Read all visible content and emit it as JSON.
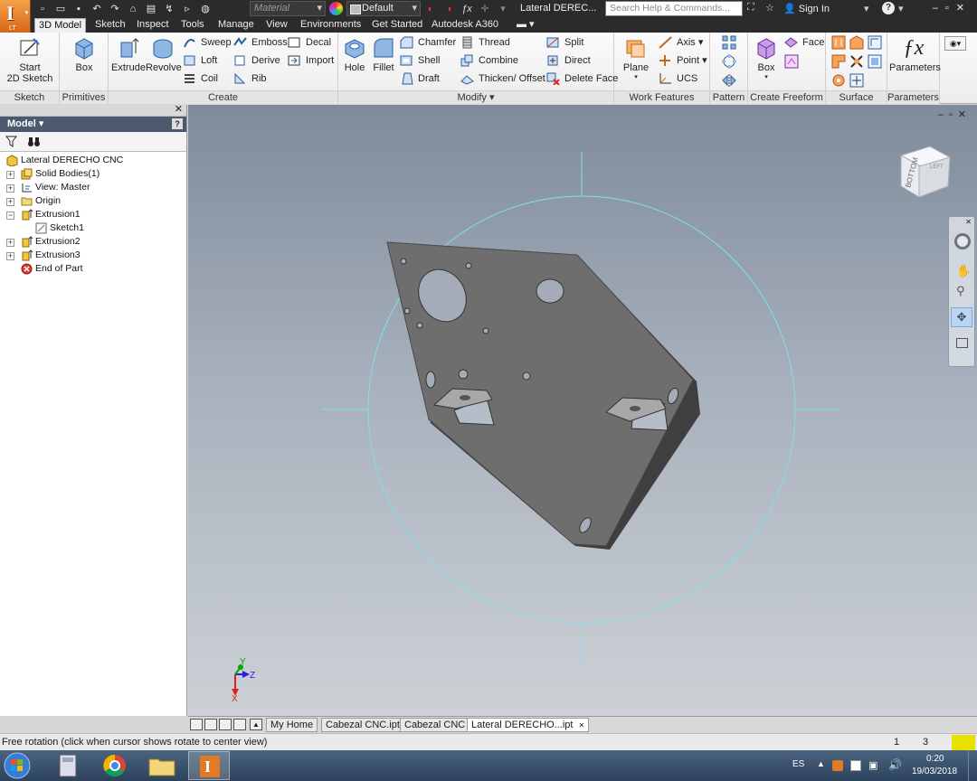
{
  "titlebar": {
    "app_letter": "I",
    "app_edition": "LT",
    "material_placeholder": "Material",
    "appearance_value": "Default",
    "document_title": "Lateral DEREC...",
    "search_placeholder": "Search Help & Commands...",
    "sign_in": "Sign In",
    "help": "?"
  },
  "tabs": [
    "3D Model",
    "Sketch",
    "Inspect",
    "Tools",
    "Manage",
    "View",
    "Environments",
    "Get Started",
    "Autodesk A360"
  ],
  "active_tab": "3D Model",
  "ribbon": {
    "sketch_panel": {
      "title": "Sketch",
      "start_sketch": "Start\n2D Sketch"
    },
    "primitives_panel": {
      "title": "Primitives",
      "box": "Box"
    },
    "create_panel": {
      "title": "Create",
      "extrude": "Extrude",
      "revolve": "Revolve",
      "sweep": "Sweep",
      "loft": "Loft",
      "coil": "Coil",
      "emboss": "Emboss",
      "derive": "Derive",
      "rib": "Rib",
      "decal": "Decal",
      "import": "Import"
    },
    "modify_panel": {
      "title": "Modify ▾",
      "hole": "Hole",
      "fillet": "Fillet",
      "chamfer": "Chamfer",
      "shell": "Shell",
      "draft": "Draft",
      "thread": "Thread",
      "combine": "Combine",
      "thicken": "Thicken/ Offset",
      "split": "Split",
      "direct": "Direct",
      "delete_face": "Delete Face"
    },
    "work_features_panel": {
      "title": "Work Features",
      "plane": "Plane",
      "axis": "Axis",
      "point": "Point",
      "ucs": "UCS"
    },
    "pattern_panel": {
      "title": "Pattern"
    },
    "freeform_panel": {
      "title": "Create Freeform",
      "box": "Box",
      "face": "Face"
    },
    "surface_panel": {
      "title": "Surface"
    },
    "parameters_panel": {
      "title": "Parameters",
      "parameters": "Parameters"
    }
  },
  "browser": {
    "title": "Model ▾",
    "help": "?",
    "tree": [
      {
        "label": "Lateral DERECHO CNC",
        "level": 0,
        "icon": "part-icon"
      },
      {
        "label": "Solid Bodies(1)",
        "level": 1,
        "icon": "solid-bodies-icon",
        "expander": "+"
      },
      {
        "label": "View: Master",
        "level": 1,
        "icon": "view-icon",
        "expander": "+"
      },
      {
        "label": "Origin",
        "level": 1,
        "icon": "folder-icon",
        "expander": "+"
      },
      {
        "label": "Extrusion1",
        "level": 1,
        "icon": "extrusion-icon",
        "expander": "−"
      },
      {
        "label": "Sketch1",
        "level": 2,
        "icon": "sketch-icon"
      },
      {
        "label": "Extrusion2",
        "level": 1,
        "icon": "extrusion-icon",
        "expander": "+"
      },
      {
        "label": "Extrusion3",
        "level": 1,
        "icon": "extrusion-icon",
        "expander": "+"
      },
      {
        "label": "End of Part",
        "level": 1,
        "icon": "end-of-part-icon"
      }
    ]
  },
  "viewcube": {
    "face_label": "BOTTOM",
    "side_label": "LEFT"
  },
  "triad": {
    "x": "X",
    "y": "Y",
    "z": "Z"
  },
  "doc_tabs": [
    "My Home",
    "Cabezal CNC.ipt",
    "Cabezal CNC",
    "Lateral DERECHO...ipt"
  ],
  "active_doc_tab": "Lateral DERECHO...ipt",
  "status": {
    "message": "Free rotation (click when cursor shows rotate to center view)",
    "count1": "1",
    "count2": "3"
  },
  "taskbar": {
    "language": "ES",
    "time": "0:20",
    "date": "19/03/2018"
  },
  "colors": {
    "accent_orange": "#e07a24",
    "orbit_circle": "#7fe0ea",
    "plate": "#6e6e6e"
  }
}
